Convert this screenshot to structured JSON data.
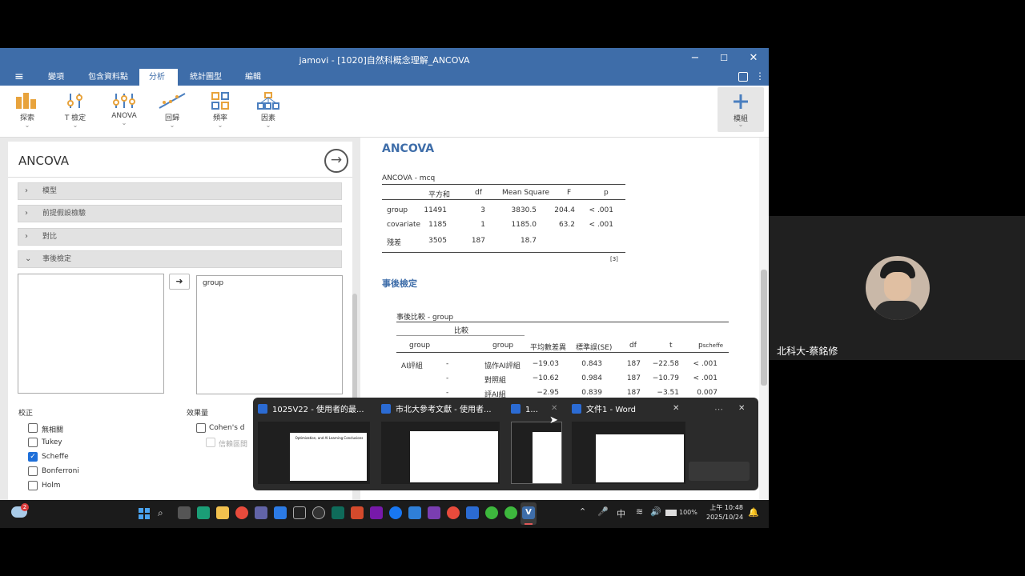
{
  "window": {
    "title": "jamovi - [1020]自然科概念理解_ANCOVA",
    "menu": [
      "",
      "變項",
      "包含資料點",
      "分析",
      "統計圖型",
      "編輯"
    ],
    "active_menu": "分析"
  },
  "ribbon": [
    {
      "label": "探索",
      "icon": "bar-chart-icon"
    },
    {
      "label": "T 檢定",
      "icon": "ttest-icon"
    },
    {
      "label": "ANOVA",
      "icon": "anova-icon"
    },
    {
      "label": "回歸",
      "icon": "regression-icon"
    },
    {
      "label": "頻率",
      "icon": "frequencies-icon"
    },
    {
      "label": "因素",
      "icon": "factor-icon"
    },
    {
      "label": "模組",
      "icon": "plus-icon"
    }
  ],
  "analysis_panel": {
    "title": "ANCOVA",
    "sections": [
      "模型",
      "前提假設檢驗",
      "對比",
      "事後檢定"
    ],
    "selected_var": "group",
    "correction": {
      "label": "校正",
      "options": [
        {
          "label": "無相關",
          "checked": false
        },
        {
          "label": "Tukey",
          "checked": false
        },
        {
          "label": "Scheffe",
          "checked": true
        },
        {
          "label": "Bonferroni",
          "checked": false
        },
        {
          "label": "Holm",
          "checked": false
        }
      ]
    },
    "effect_size": {
      "label": "效果量",
      "options": [
        {
          "label": "Cohen's d",
          "checked": false
        },
        {
          "label": "信賴區間",
          "checked": false
        }
      ]
    }
  },
  "results": {
    "heading": "ANCOVA",
    "anova_table": {
      "caption": "ANCOVA - mcq",
      "headers": [
        "",
        "平方和",
        "df",
        "Mean Square",
        "F",
        "p"
      ],
      "rows": [
        [
          "group",
          "11491",
          "3",
          "3830.5",
          "204.4",
          "< .001"
        ],
        [
          "covariate",
          "1185",
          "1",
          "1185.0",
          "63.2",
          "< .001"
        ],
        [
          "殘差",
          "3505",
          "187",
          "18.7",
          "",
          ""
        ]
      ],
      "footnote": "[3]"
    },
    "posthoc_heading": "事後檢定",
    "posthoc_table": {
      "caption": "事後比較 - group",
      "group_header": "比較",
      "headers": [
        "group",
        "",
        "group",
        "平均數差異",
        "標準誤(SE)",
        "df",
        "t",
        "p"
      ],
      "p_sub": "scheffe",
      "rows": [
        [
          "AI評組",
          "-",
          "協作AI評組",
          "−19.03",
          "0.843",
          "187",
          "−22.58",
          "< .001"
        ],
        [
          "",
          "-",
          "對照組",
          "−10.62",
          "0.984",
          "187",
          "−10.79",
          "< .001"
        ],
        [
          "",
          "-",
          "評AI組",
          "−2.95",
          "0.839",
          "187",
          "−3.51",
          "0.007"
        ]
      ]
    }
  },
  "switcher": {
    "items": [
      {
        "title": "1025V22 - 使用者的最...",
        "app": "word-icon",
        "doc_title": "Optimization, and AI Learning Conclusions"
      },
      {
        "title": "市北大參考文獻 - 使用者...",
        "app": "word-icon"
      },
      {
        "title": "1...",
        "app": "word-icon"
      },
      {
        "title": "文件1 - Word",
        "app": "word-icon"
      }
    ]
  },
  "taskbar": {
    "notification_count": "2",
    "time": "上午 10:48",
    "date": "2025/10/24",
    "battery": "100%",
    "ime": "中"
  },
  "webcam": {
    "name": "北科大-蔡銘修"
  },
  "colors": {
    "accent": "#3e6da9",
    "results_heading": "#3e6da9",
    "checkbox": "#1e6fd9"
  }
}
